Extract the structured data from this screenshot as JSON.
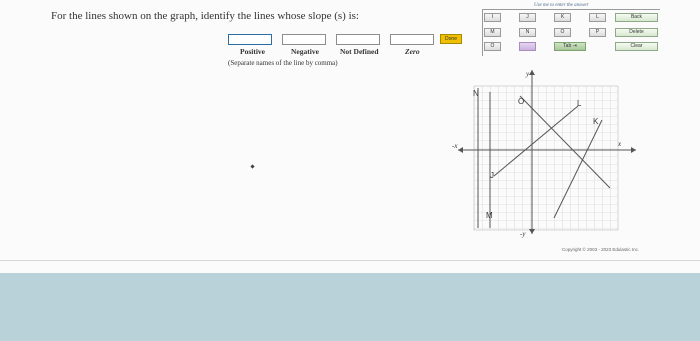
{
  "question": "For the lines shown on the graph, identify the lines whose slope (s) is:",
  "columns": {
    "positive": "Positive",
    "negative": "Negative",
    "not_defined": "Not Defined",
    "zero": "Zero"
  },
  "hint": "(Separate names of the line by comma)",
  "done_label": "Done",
  "keypad": {
    "title": "Use me to enter the answer",
    "row1": [
      "I",
      "J",
      "K",
      "L"
    ],
    "row2": [
      "M",
      "N",
      "O",
      "P"
    ],
    "row3_left": "O",
    "tab": "Tab",
    "back": "Back",
    "delete": "Delete",
    "clear": "Clear"
  },
  "graph": {
    "line_labels": [
      "N",
      "O",
      "L",
      "K",
      "J",
      "M"
    ],
    "axis_x_pos": "x",
    "axis_x_neg": "-x",
    "axis_y_pos": "y",
    "axis_y_neg": "-y"
  },
  "copyright": "Copyright © 2003 - 2023 Edulastic Inc."
}
